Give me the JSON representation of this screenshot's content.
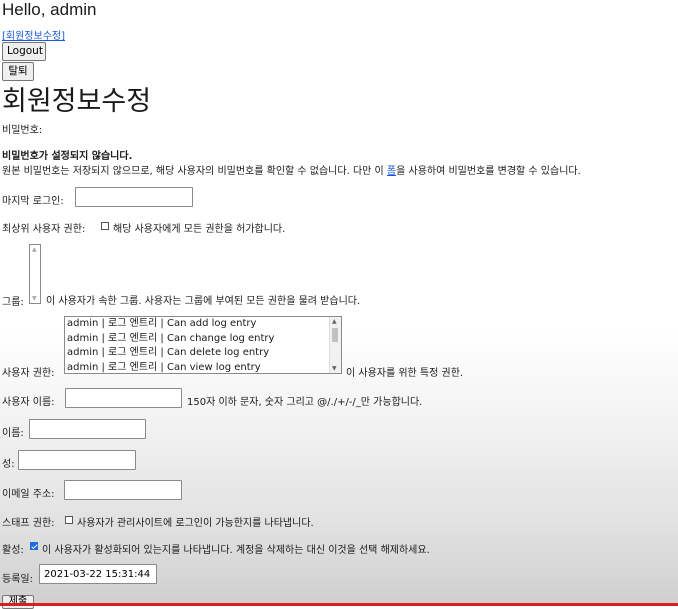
{
  "header": {
    "greeting": "Hello, admin",
    "edit_link": "[회원정보수정]",
    "logout_label": "Logout",
    "withdraw_label": "탈퇴"
  },
  "page": {
    "title": "회원정보수정"
  },
  "form": {
    "password": {
      "label": "비밀번호:",
      "notice": "비밀번호가 설정되지 않습니다.",
      "help_before": "원본 비밀번호는 저장되지 않으므로, 해당 사용자의 비밀번호를 확인할 수 없습니다. 다만 이 ",
      "help_link": "폼",
      "help_after": "을 사용하여 비밀번호를 변경할 수 있습니다."
    },
    "last_login": {
      "label": "마지막 로그인:",
      "value": ""
    },
    "superuser": {
      "label": "최상위 사용자 권한:",
      "checked": false,
      "help": "해당 사용자에게 모든 권한을 허가합니다."
    },
    "groups": {
      "label": "그룹:",
      "help": "이 사용자가 속한 그룹. 사용자는 그룹에 부여된 모든 권한을 물려 받습니다."
    },
    "permissions": {
      "label": "사용자 권한:",
      "options": [
        "admin | 로그 엔트리 | Can add log entry",
        "admin | 로그 엔트리 | Can change log entry",
        "admin | 로그 엔트리 | Can delete log entry",
        "admin | 로그 엔트리 | Can view log entry"
      ],
      "help": "이 사용자를 위한 특정 권한."
    },
    "username": {
      "label": "사용자 이름:",
      "value": "",
      "help": "150자 이하 문자, 숫자 그리고 @/./+/-/_만 가능합니다."
    },
    "first_name": {
      "label": "이름:",
      "value": ""
    },
    "last_name": {
      "label": "성:",
      "value": ""
    },
    "email": {
      "label": "이메일 주소:",
      "value": ""
    },
    "staff": {
      "label": "스태프 권한:",
      "checked": false,
      "help": "사용자가 관리사이트에 로그인이 가능한지를 나타냅니다."
    },
    "active": {
      "label": "활성:",
      "checked": true,
      "help": "이 사용자가 활성화되어 있는지를 나타냅니다. 계정을 삭제하는 대신 이것을 선택 해제하세요."
    },
    "date_joined": {
      "label": "등록일:",
      "value": "2021-03-22 15:31:44"
    },
    "submit_label": "제출"
  }
}
